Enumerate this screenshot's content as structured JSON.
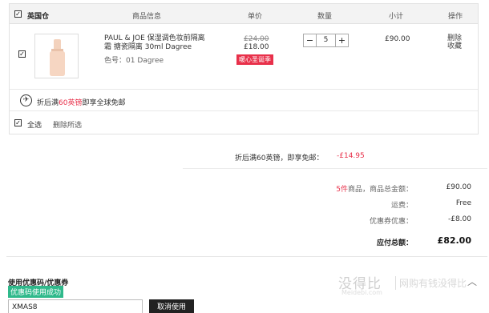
{
  "header": {
    "warehouse": "英国仓",
    "col_product": "商品信息",
    "col_price": "单价",
    "col_qty": "数量",
    "col_subtotal": "小计",
    "col_action": "操作"
  },
  "item": {
    "name": "PAUL & JOE 保湿调色妆前隔离霜 搪瓷隔离 30ml Dagree",
    "color": "色号：01 Dagree",
    "price_old": "£24.00",
    "price_new": "£18.00",
    "promo_badge": "暖心圣诞季",
    "qty_minus": "−",
    "qty": "5",
    "qty_plus": "+",
    "subtotal": "£90.00",
    "delete": "删除",
    "favorite": "收藏"
  },
  "shipping": {
    "prefix": "折后满",
    "amount": "60英镑",
    "suffix": "即享全球免邮"
  },
  "selection": {
    "select_all": "全选",
    "delete_selected": "删除所选"
  },
  "summary": {
    "free_ship_note": "折后满60英镑，即享免邮：",
    "free_ship_amount": "-£14.95",
    "count": "5件",
    "goods_total_label": "商品，商品总金额：",
    "goods_total": "£90.00",
    "shipping_label": "运费：",
    "shipping": "Free",
    "coupon_label": "优惠券优惠：",
    "coupon": "-£8.00",
    "total_label": "应付总额：",
    "total": "£82.00"
  },
  "coupon": {
    "title": "使用优惠码/优惠券",
    "success": "优惠码使用成功",
    "code": "XMAS8",
    "cancel": "取消使用"
  },
  "watermark": {
    "brand": "没得比",
    "site": "Meidebi.com",
    "slogan": "网购有钱没得比"
  },
  "colors": {
    "accent_red": "#e8304a",
    "success_green": "#2fb98b"
  }
}
